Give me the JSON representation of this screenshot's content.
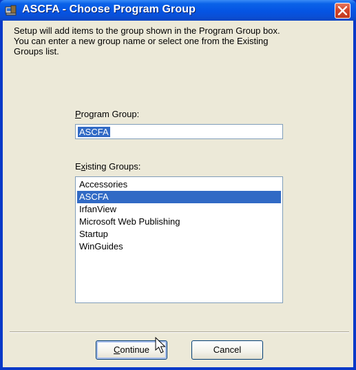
{
  "window": {
    "title": "ASCFA - Choose Program Group",
    "icon": "setup-icon"
  },
  "message": {
    "lines": [
      "Setup will add items to the group shown in the Program Group box.",
      "You can enter a new group name or select one from the Existing",
      "Groups list."
    ]
  },
  "program_group": {
    "label_accel": "P",
    "label_rest": "rogram Group:",
    "value": "ASCFA"
  },
  "existing_groups": {
    "label_pre": "E",
    "label_accel": "x",
    "label_rest": "isting Groups:",
    "items": [
      "Accessories",
      "ASCFA",
      "IrfanView",
      "Microsoft Web Publishing",
      "Startup",
      "WinGuides"
    ],
    "selected_index": 1
  },
  "buttons": {
    "continue_accel": "C",
    "continue_rest": "ontinue",
    "cancel": "Cancel"
  },
  "colors": {
    "title_bar": "#0554e3",
    "selection": "#316ac5",
    "dialog_bg": "#ece9d8"
  }
}
